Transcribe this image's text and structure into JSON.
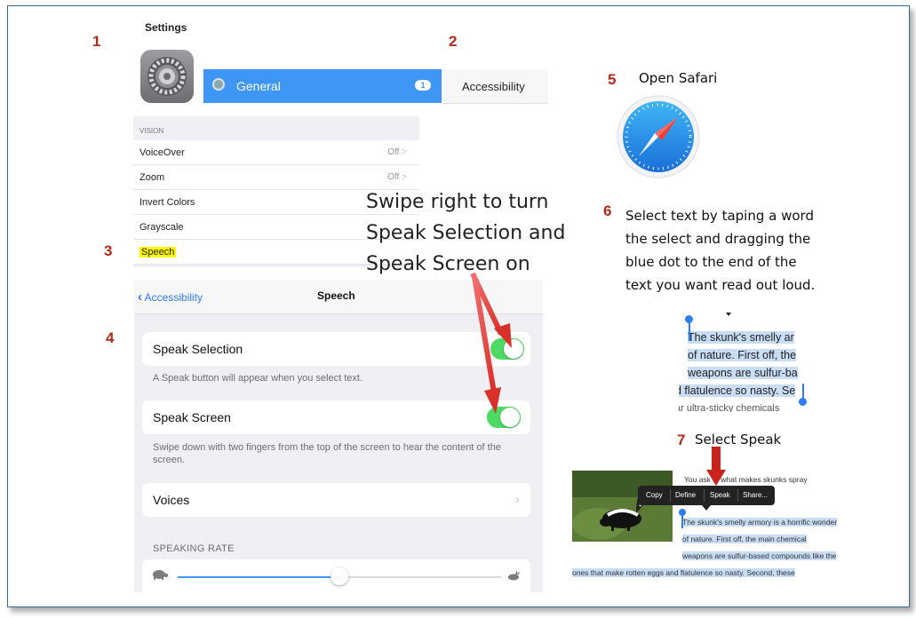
{
  "steps": {
    "s1": "1",
    "s2": "2",
    "s3": "3",
    "s4": "4",
    "s5": "5",
    "s6": "6",
    "s7": "7"
  },
  "settings": {
    "title": "Settings",
    "general_label": "General",
    "badge": "1",
    "accessibility_header": "Accessibility"
  },
  "vision": {
    "header": "VISION",
    "rows": [
      {
        "label": "VoiceOver",
        "value": "Off"
      },
      {
        "label": "Zoom",
        "value": "Off"
      },
      {
        "label": "Invert Colors",
        "value": ""
      },
      {
        "label": "Grayscale",
        "value": ""
      },
      {
        "label": "Speech",
        "value": ""
      }
    ]
  },
  "speech": {
    "back": "Accessibility",
    "title": "Speech",
    "speak_selection": "Speak Selection",
    "speak_selection_desc": "A Speak button will appear when you select text.",
    "speak_screen": "Speak Screen",
    "speak_screen_desc": "Swipe down with two fingers from the top of the screen to hear the content of the screen.",
    "voices": "Voices",
    "speaking_rate": "SPEAKING RATE",
    "rate_value": 0.5
  },
  "notes": {
    "swipe_line1": "Swipe right to turn",
    "swipe_line2": "Speak Selection and",
    "swipe_line3": "Speak Screen on",
    "open_safari": "Open Safari",
    "select_line1": "Select text by taping a word",
    "select_line2": "the select and dragging the",
    "select_line3": "blue dot to the end of the",
    "select_line4": "text you want read out loud.",
    "select_speak": "Select Speak"
  },
  "selection_sample": {
    "l1": "The skunk's smelly ar",
    "l2": "of nature. First off, the",
    "l3": "weapons are sulfur-ba",
    "l4": "d flatulence so nasty. Se",
    "l5": "ar ultra-sticky chemicals"
  },
  "popup": {
    "copy": "Copy",
    "define": "Define",
    "speak": "Speak",
    "share": "Share..."
  },
  "step7_text": {
    "l0": "You ask            s, what makes skunks spray",
    "l1": "The skunk's smelly armory is a horrific wonder",
    "l2": "of nature. First off, the main chemical",
    "l3": "weapons are sulfur-based compounds like the",
    "l4": "ones that make rotten eggs and flatulence so nasty. Second, these"
  },
  "colors": {
    "accent": "#3e96f5",
    "toggle_on": "#4cd964",
    "step_number": "#b22a1a",
    "highlight": "#fff700",
    "arrow": "#d9302a",
    "selection": "#c9ddf4"
  }
}
